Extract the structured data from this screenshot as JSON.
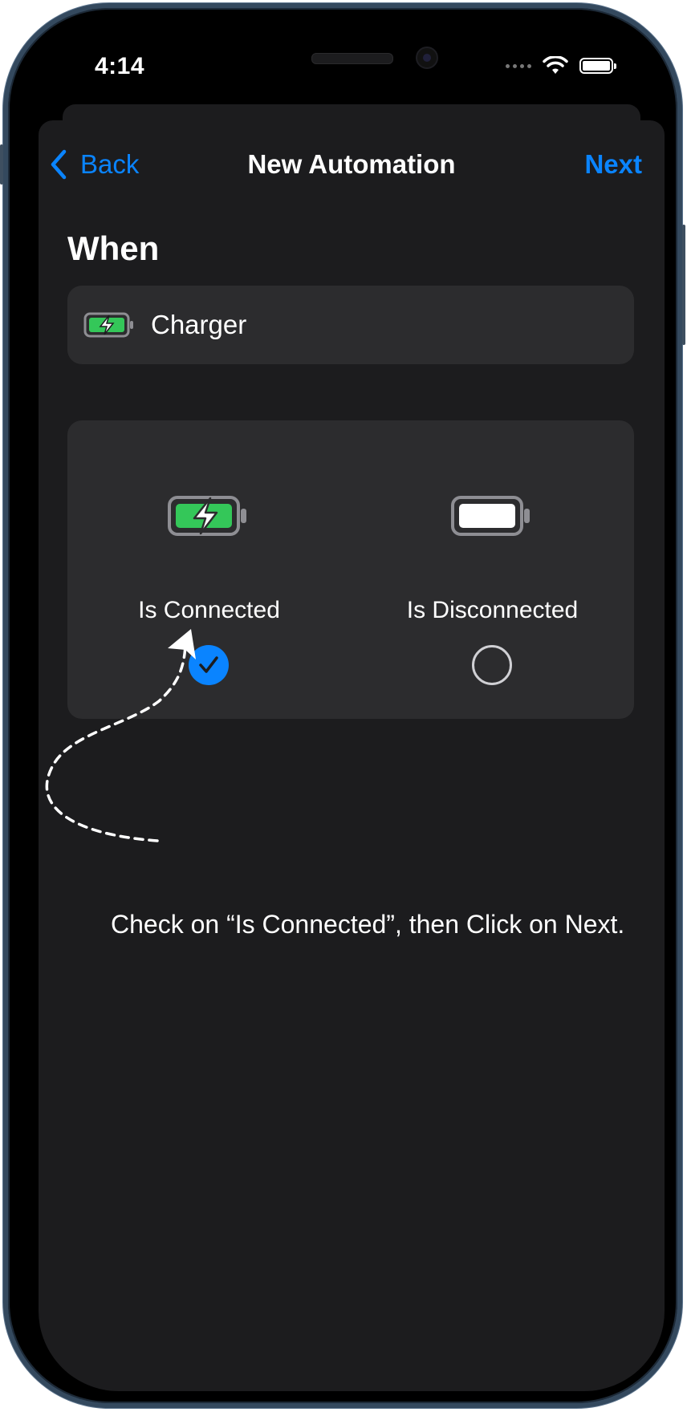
{
  "status_bar": {
    "time": "4:14"
  },
  "nav": {
    "back_label": "Back",
    "title": "New Automation",
    "next_label": "Next"
  },
  "when": {
    "heading": "When",
    "trigger_label": "Charger",
    "trigger_icon": "battery-charging-icon"
  },
  "options": [
    {
      "label": "Is Connected",
      "icon": "battery-charging-icon",
      "selected": true
    },
    {
      "label": "Is Disconnected",
      "icon": "battery-full-icon",
      "selected": false
    }
  ],
  "annotation": {
    "text": "Check on “Is Connected”, then Click on Next."
  },
  "colors": {
    "accent": "#0a84ff",
    "background": "#1c1c1e",
    "card": "#2c2c2e",
    "battery_green": "#34c759",
    "frame": "#34495e"
  }
}
